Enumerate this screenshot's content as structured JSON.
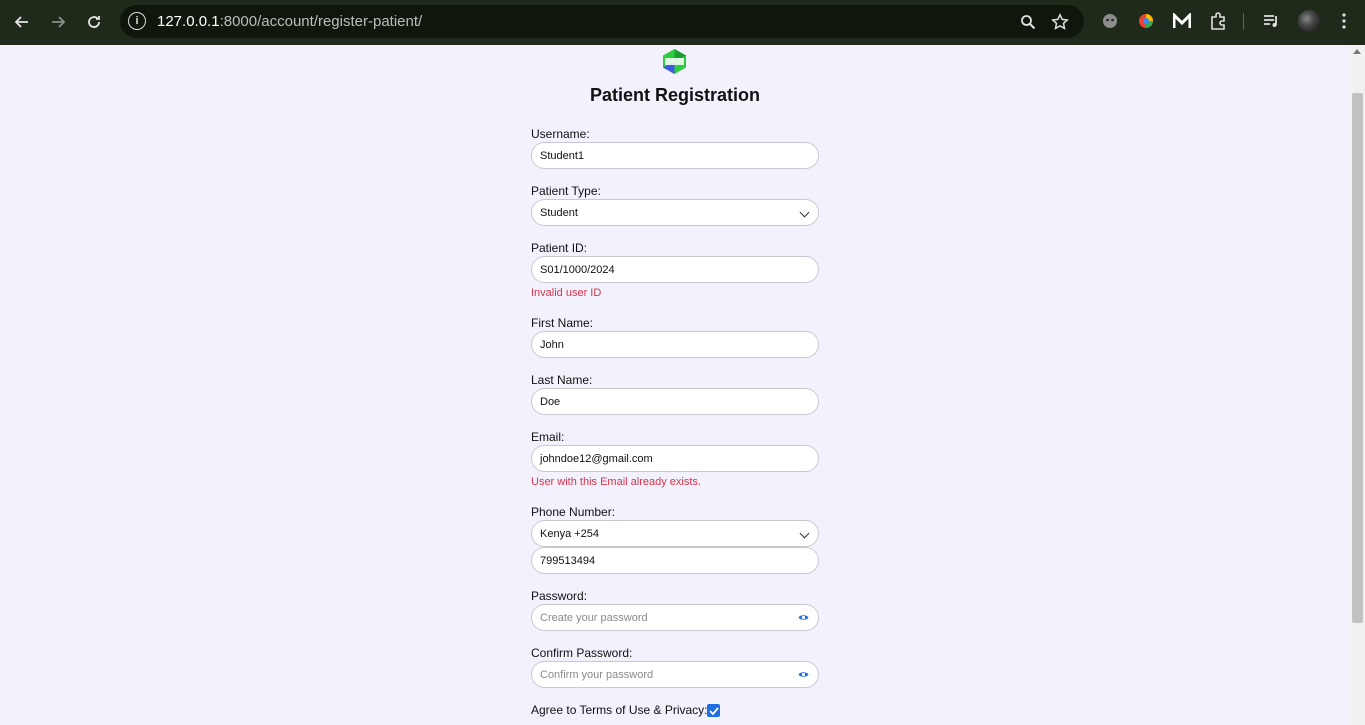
{
  "browser": {
    "url_host": "127.0.0.1",
    "url_path": ":8000/account/register-patient/"
  },
  "page": {
    "title": "Patient Registration"
  },
  "form": {
    "username": {
      "label": "Username:",
      "value": "Student1"
    },
    "patient_type": {
      "label": "Patient Type:",
      "value": "Student"
    },
    "patient_id": {
      "label": "Patient ID:",
      "value": "S01/1000/2024",
      "error": "Invalid user ID"
    },
    "first_name": {
      "label": "First Name:",
      "value": "John"
    },
    "last_name": {
      "label": "Last Name:",
      "value": "Doe"
    },
    "email": {
      "label": "Email:",
      "value": "johndoe12@gmail.com",
      "error": "User with this Email already exists."
    },
    "phone": {
      "label": "Phone Number:",
      "country": "Kenya +254",
      "number": "799513494"
    },
    "password": {
      "label": "Password:",
      "placeholder": "Create your password"
    },
    "confirm_password": {
      "label": "Confirm Password:",
      "placeholder": "Confirm your password"
    },
    "terms": {
      "label": "Agree to Terms of Use & Privacy:",
      "checked": true
    }
  },
  "colors": {
    "accent": "#1f6fe0",
    "error": "#d8334a",
    "page_bg": "#f3f1fb"
  },
  "icons": [
    "back-arrow-icon",
    "forward-arrow-icon",
    "reload-icon",
    "info-icon",
    "zoom-icon",
    "star-icon",
    "extensions-icon",
    "media-icon",
    "eye-icon",
    "chevron-down-icon",
    "checkmark-icon"
  ]
}
